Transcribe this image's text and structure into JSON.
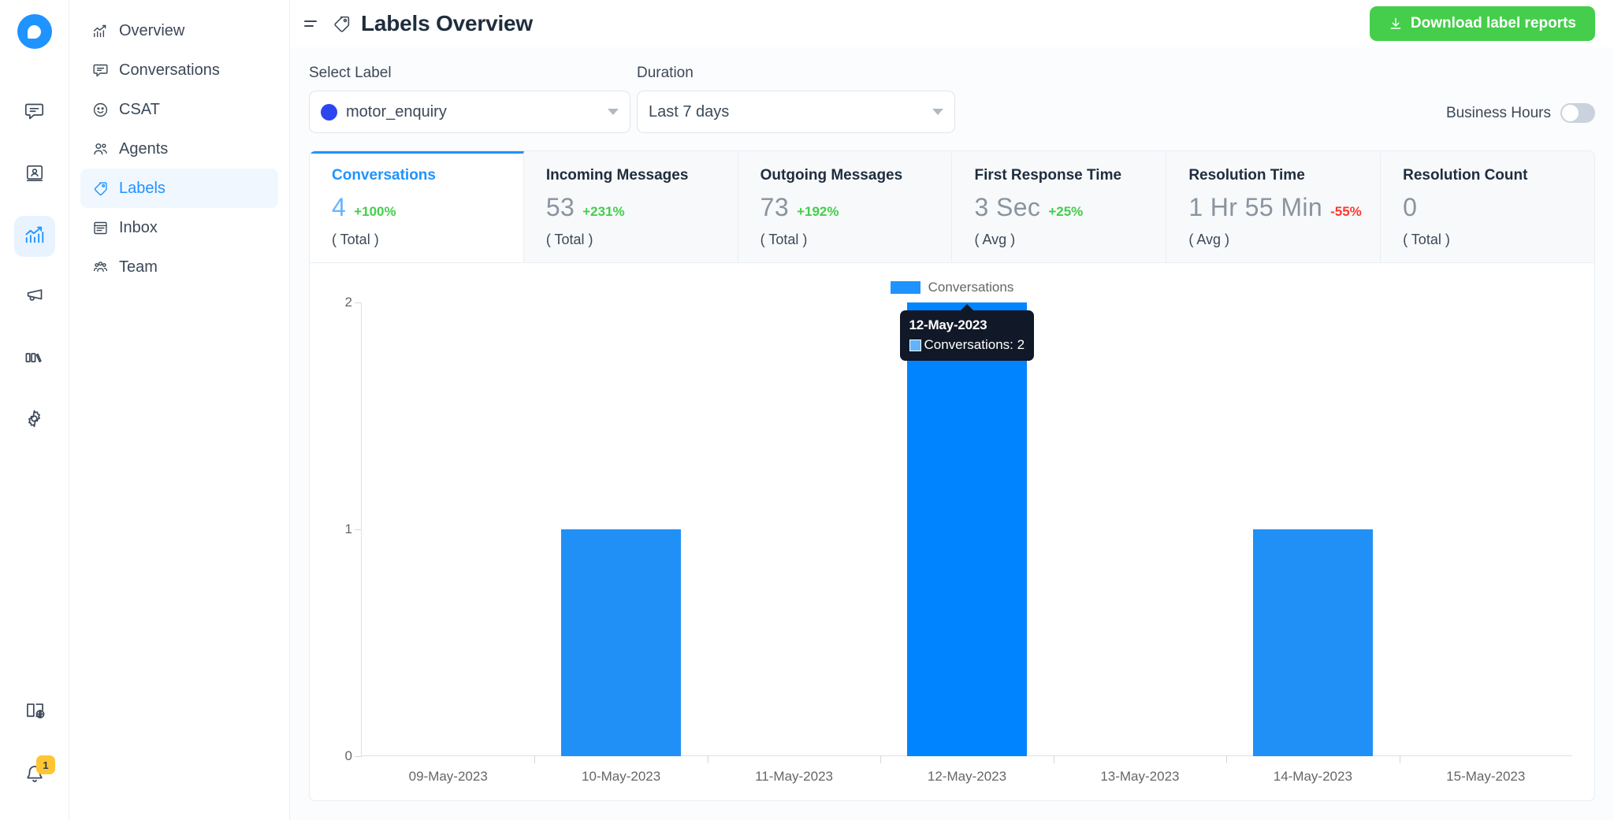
{
  "rail": {
    "logo": "chatwoot-logo",
    "items": [
      {
        "name": "conversations",
        "icon": "chat-bubble-icon",
        "active": false
      },
      {
        "name": "contacts",
        "icon": "contact-book-icon",
        "active": false
      },
      {
        "name": "reports",
        "icon": "analytics-chart-icon",
        "active": true
      },
      {
        "name": "campaigns",
        "icon": "megaphone-icon",
        "active": false
      },
      {
        "name": "help-center",
        "icon": "books-icon",
        "active": false
      },
      {
        "name": "settings",
        "icon": "gear-icon",
        "active": false
      }
    ],
    "bottom": [
      {
        "name": "docs",
        "icon": "book-globe-icon"
      },
      {
        "name": "notifications",
        "icon": "bell-icon",
        "badge": "1"
      }
    ]
  },
  "sidebar": {
    "items": [
      {
        "label": "Overview",
        "icon": "trend-chart-icon",
        "active": false
      },
      {
        "label": "Conversations",
        "icon": "chat-bubble-icon",
        "active": false
      },
      {
        "label": "CSAT",
        "icon": "smiley-icon",
        "active": false
      },
      {
        "label": "Agents",
        "icon": "people-icon",
        "active": false
      },
      {
        "label": "Labels",
        "icon": "tag-icon",
        "active": true
      },
      {
        "label": "Inbox",
        "icon": "inbox-icon",
        "active": false
      },
      {
        "label": "Team",
        "icon": "team-icon",
        "active": false
      }
    ]
  },
  "header": {
    "menu_icon": "hamburger-icon",
    "page_icon": "tag-icon",
    "title": "Labels Overview",
    "download_label": "Download label reports",
    "download_icon": "download-icon",
    "download_color": "#44ce4b"
  },
  "filters": {
    "label_caption": "Select Label",
    "label_value": "motor_enquiry",
    "label_dot_color": "#2b46ee",
    "duration_caption": "Duration",
    "duration_value": "Last 7 days",
    "business_hours_label": "Business Hours",
    "business_hours_on": false
  },
  "metrics": [
    {
      "name": "Conversations",
      "value": "4",
      "delta": "+100%",
      "delta_dir": "up",
      "sub": "( Total )",
      "active": true
    },
    {
      "name": "Incoming Messages",
      "value": "53",
      "delta": "+231%",
      "delta_dir": "up",
      "sub": "( Total )",
      "active": false
    },
    {
      "name": "Outgoing Messages",
      "value": "73",
      "delta": "+192%",
      "delta_dir": "up",
      "sub": "( Total )",
      "active": false
    },
    {
      "name": "First Response Time",
      "value": "3 Sec",
      "delta": "+25%",
      "delta_dir": "up",
      "sub": "( Avg )",
      "active": false
    },
    {
      "name": "Resolution Time",
      "value": "1 Hr 55 Min",
      "delta": "-55%",
      "delta_dir": "down",
      "sub": "( Avg )",
      "active": false
    },
    {
      "name": "Resolution Count",
      "value": "0",
      "delta": "",
      "delta_dir": "",
      "sub": "( Total )",
      "active": false
    }
  ],
  "chart_data": {
    "type": "bar",
    "title": "",
    "xlabel": "",
    "ylabel": "",
    "ylim": [
      0,
      2
    ],
    "yticks": [
      0,
      1,
      2
    ],
    "grid": false,
    "legend": {
      "position": "top-center",
      "entries": [
        {
          "name": "Conversations",
          "color": "#1f93ff"
        }
      ]
    },
    "categories": [
      "09-May-2023",
      "10-May-2023",
      "11-May-2023",
      "12-May-2023",
      "13-May-2023",
      "14-May-2023",
      "15-May-2023"
    ],
    "series": [
      {
        "name": "Conversations",
        "color": "#2190f6",
        "values": [
          0,
          1,
          0,
          2,
          0,
          1,
          0
        ]
      }
    ],
    "hovered_index": 3,
    "hover_color": "#0084ff"
  },
  "tooltip": {
    "title": "12-May-2023",
    "series_label": "Conversations: 2",
    "swatch_color": "#62b3ff",
    "background": "#111827"
  }
}
